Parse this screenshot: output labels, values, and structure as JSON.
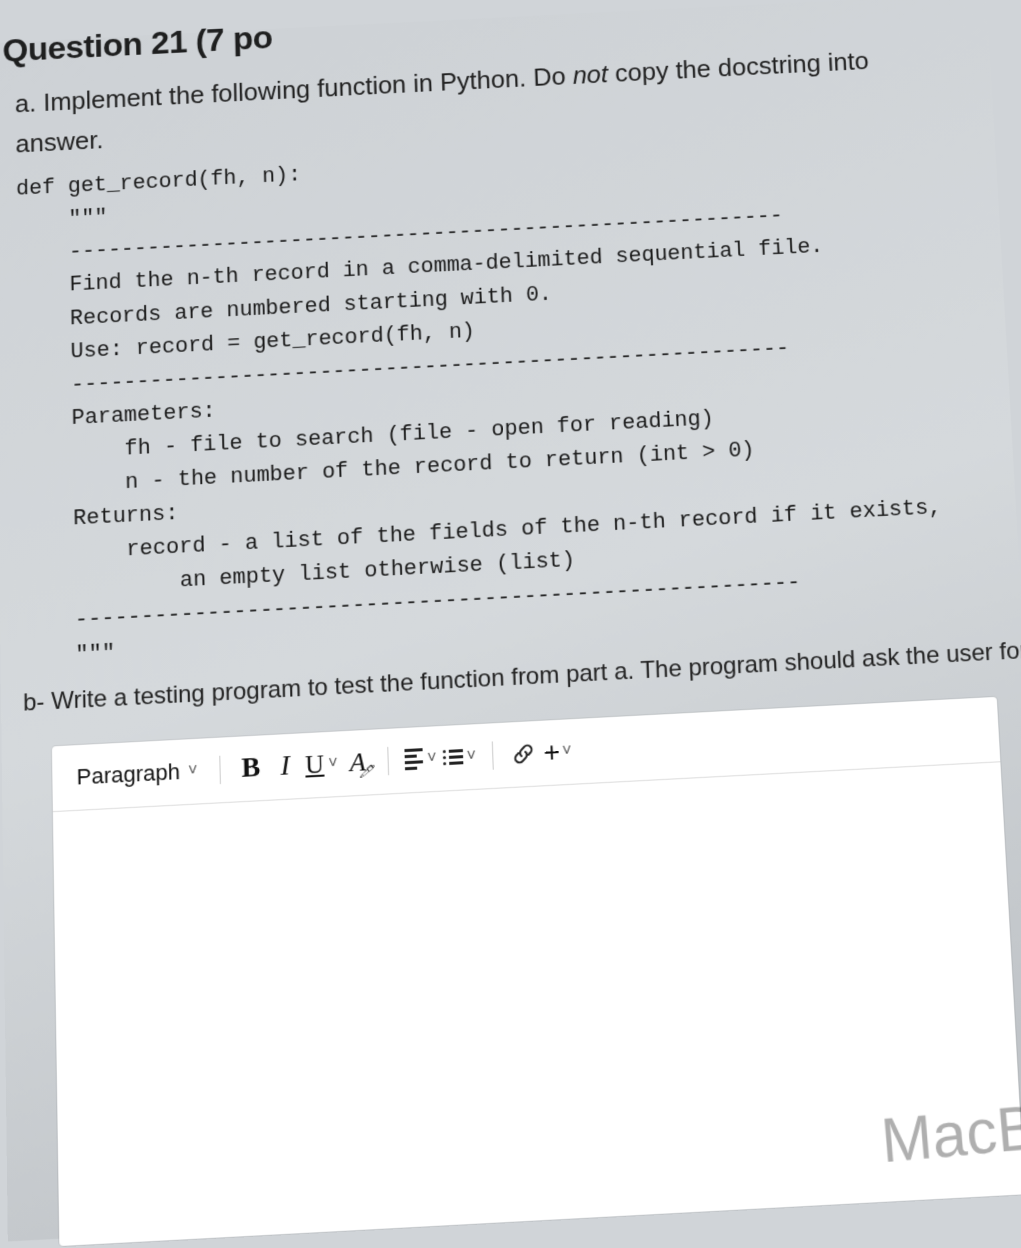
{
  "header_fragment": "Question 21 (7 po",
  "part_a_prefix": "a. Implement the following function in Python. Do ",
  "part_a_not": "not",
  "part_a_suffix": " copy the docstring into",
  "part_a_line2": "answer.",
  "code_lines": [
    "def get_record(fh, n):",
    "    \"\"\"",
    "    -------------------------------------------------------",
    "    Find the n-th record in a comma-delimited sequential file.",
    "    Records are numbered starting with 0.",
    "    Use: record = get_record(fh, n)",
    "    -------------------------------------------------------",
    "    Parameters:",
    "        fh - file to search (file - open for reading)",
    "        n - the number of the record to return (int > 0)",
    "    Returns:",
    "        record - a list of the fields of the n-th record if it exists,",
    "            an empty list otherwise (list)",
    "    -------------------------------------------------------",
    "    \"\"\""
  ],
  "part_b": "b- Write a testing program to test the function from part a. The program should ask the user for a fil",
  "toolbar": {
    "style_label": "Paragraph",
    "bold": "B",
    "italic": "I",
    "underline": "U",
    "font_color": "A",
    "plus": "+"
  },
  "laptop_brand": "MacBo"
}
